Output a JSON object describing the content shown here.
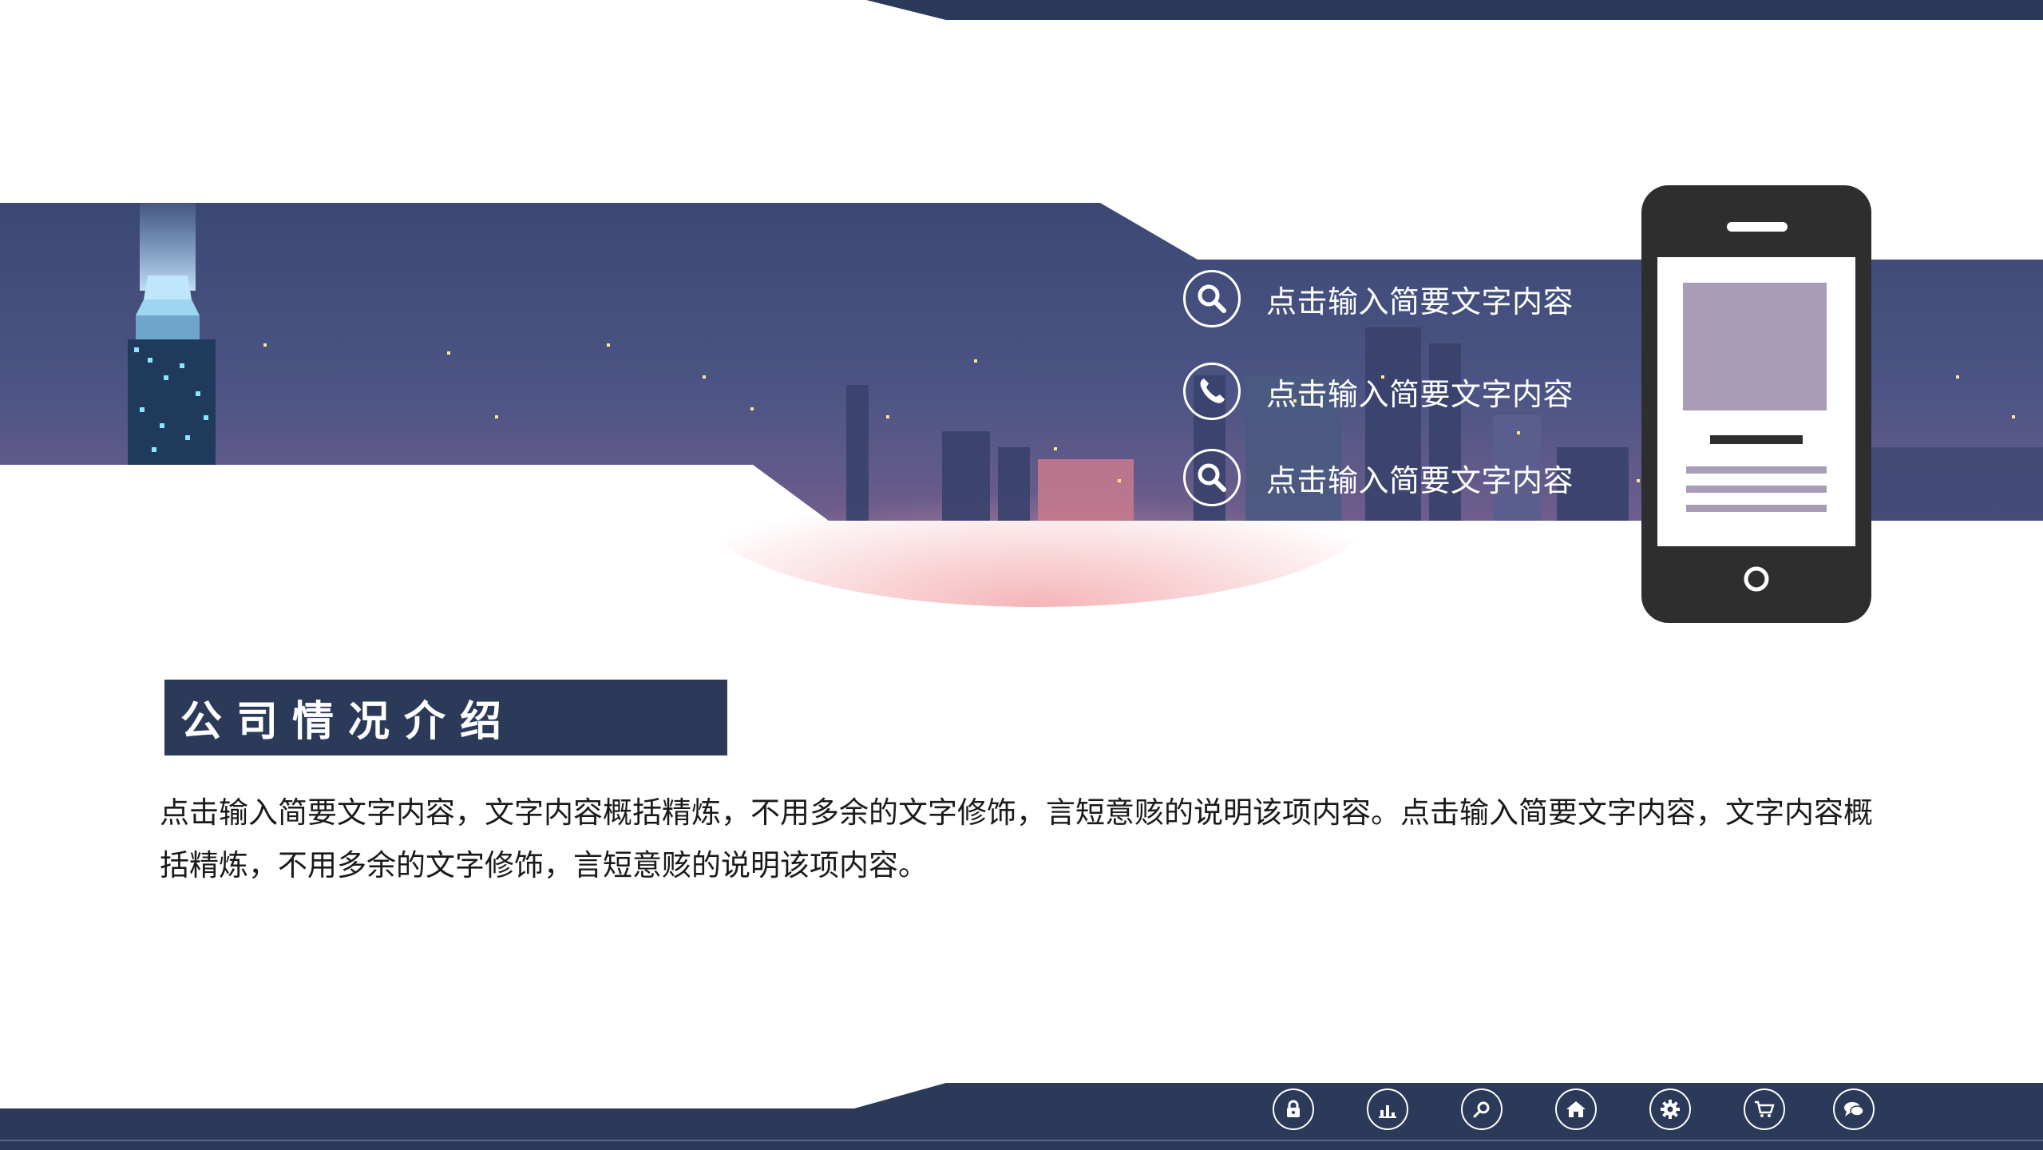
{
  "features": [
    {
      "icon": "magnifier-icon",
      "label": "点击输入简要文字内容"
    },
    {
      "icon": "phone-icon",
      "label": "点击输入简要文字内容"
    },
    {
      "icon": "magnifier-icon",
      "label": "点击输入简要文字内容"
    }
  ],
  "section": {
    "title": "公司情况介绍",
    "body": "点击输入简要文字内容，文字内容概括精炼，不用多余的文字修饰，言短意赅的说明该项内容。点击输入简要文字内容，文字内容概括精炼，不用多余的文字修饰，言短意赅的说明该项内容。"
  },
  "footer_icons": [
    "lock-icon",
    "chart-icon",
    "search-icon",
    "home-icon",
    "gear-icon",
    "cart-icon",
    "chat-icon"
  ],
  "colors": {
    "navy": "#2c3a5a",
    "banner_top": "#3d4c7a",
    "banner_bottom": "#6a5a88",
    "phone": "#2e2e2e",
    "placeholder": "#a89cb6"
  }
}
